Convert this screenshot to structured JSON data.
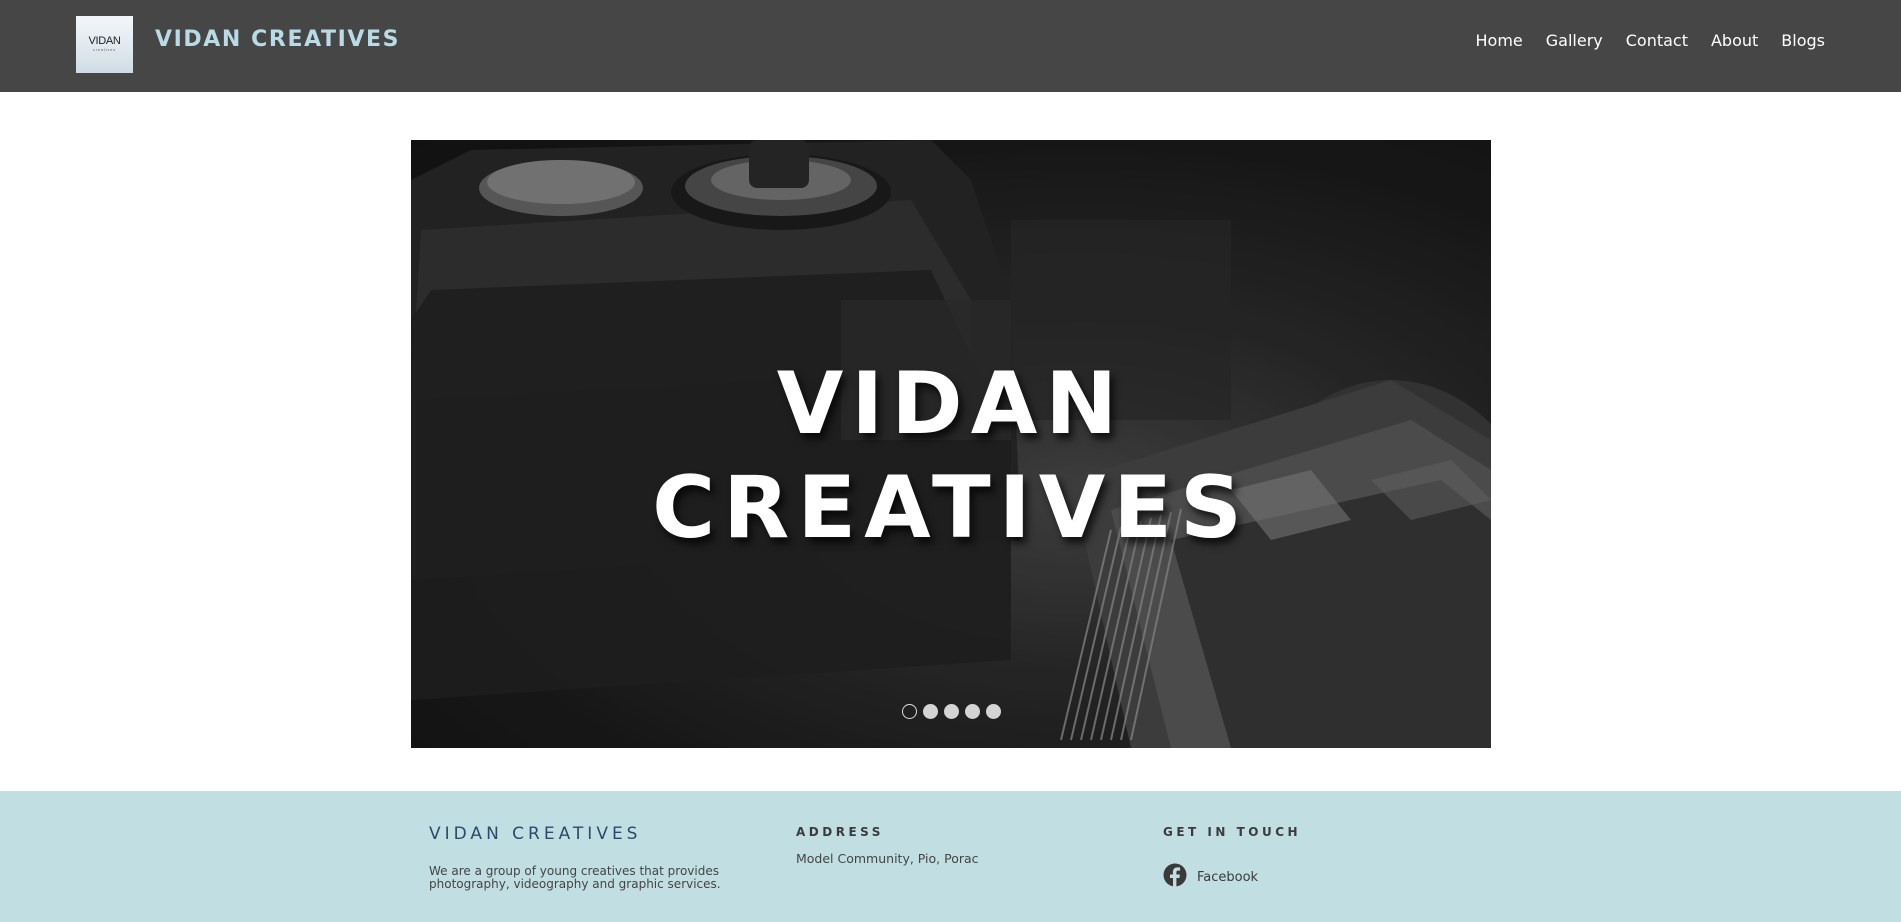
{
  "header": {
    "logo": {
      "main": "VIDAN",
      "sub": "creatives"
    },
    "brand": "VIDAN CREATIVES",
    "nav": [
      "Home",
      "Gallery",
      "Contact",
      "About",
      "Blogs"
    ]
  },
  "hero": {
    "title_line1": "VIDAN",
    "title_line2": "CREATIVES",
    "slide_count": 5,
    "active_slide": 1
  },
  "footer": {
    "brand": "VIDAN CREATIVES",
    "description": "We are a group of young creatives that provides photography, videography and graphic services.",
    "address_heading": "ADDRESS",
    "address": "Model Community, Pio, Porac",
    "contact_heading": "GET IN TOUCH",
    "facebook_label": "Facebook"
  },
  "colors": {
    "header_bg": "#464646",
    "brand_accent": "#b9dbe6",
    "footer_bg": "#c1dfe3",
    "footer_brand": "#2b4a6a"
  }
}
